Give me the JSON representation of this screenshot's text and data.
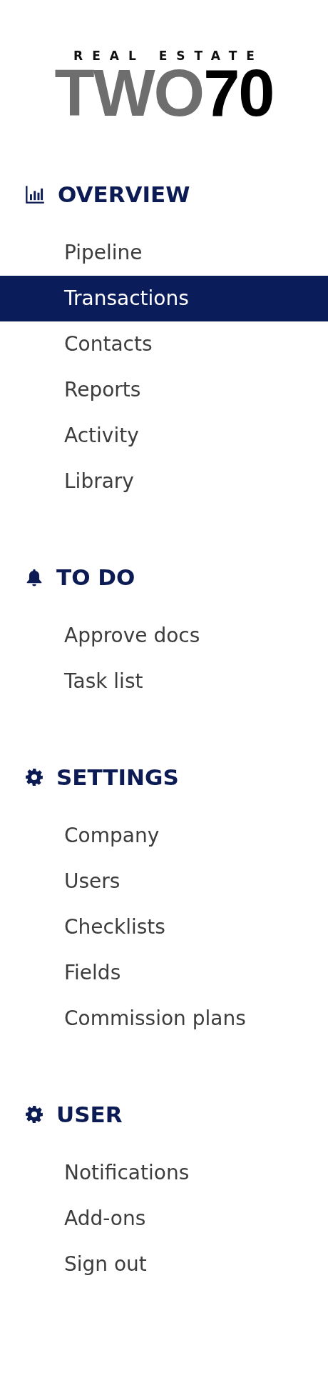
{
  "logo": {
    "tagline": "REAL ESTATE",
    "name_grey": "TWO",
    "name_black": "70"
  },
  "sections": [
    {
      "title": "OVERVIEW",
      "kind": "chart",
      "items": [
        {
          "label": "Pipeline",
          "selected": false
        },
        {
          "label": "Transactions",
          "selected": true
        },
        {
          "label": "Contacts",
          "selected": false
        },
        {
          "label": "Reports",
          "selected": false
        },
        {
          "label": "Activity",
          "selected": false
        },
        {
          "label": "Library",
          "selected": false
        }
      ]
    },
    {
      "title": "TO DO",
      "kind": "bell",
      "items": [
        {
          "label": "Approve docs",
          "selected": false
        },
        {
          "label": "Task list",
          "selected": false
        }
      ]
    },
    {
      "title": "SETTINGS",
      "kind": "gear",
      "items": [
        {
          "label": "Company",
          "selected": false
        },
        {
          "label": "Users",
          "selected": false
        },
        {
          "label": "Checklists",
          "selected": false
        },
        {
          "label": "Fields",
          "selected": false
        },
        {
          "label": "Commission plans",
          "selected": false
        }
      ]
    },
    {
      "title": "USER",
      "kind": "gear",
      "items": [
        {
          "label": "Notifications",
          "selected": false
        },
        {
          "label": "Add-ons",
          "selected": false
        },
        {
          "label": "Sign out",
          "selected": false
        }
      ]
    }
  ]
}
